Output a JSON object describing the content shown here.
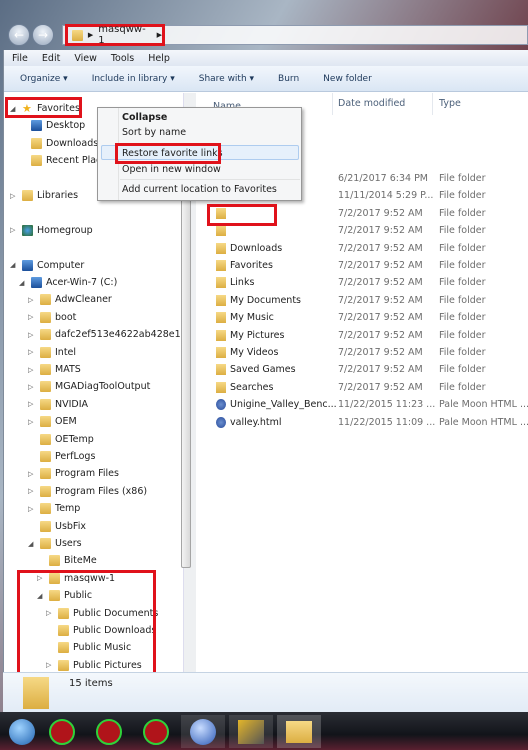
{
  "address": {
    "crumb": "masqww-1",
    "back": "back-icon",
    "forward": "forward-icon"
  },
  "menubar": [
    "File",
    "Edit",
    "View",
    "Tools",
    "Help"
  ],
  "toolbar": [
    "Organize ▾",
    "Include in library ▾",
    "Share with ▾",
    "Burn",
    "New folder"
  ],
  "nav": [
    {
      "label": "Favorites",
      "level": 0,
      "expander": "◢",
      "icon": "star",
      "gap": false
    },
    {
      "label": "Desktop",
      "level": 1,
      "expander": "",
      "icon": "desktop",
      "gap": false
    },
    {
      "label": "Downloads",
      "level": 1,
      "expander": "",
      "icon": "folder",
      "gap": false
    },
    {
      "label": "Recent Places",
      "level": 1,
      "expander": "",
      "icon": "recent",
      "gap": false
    },
    {
      "label": "Libraries",
      "level": 0,
      "expander": "▷",
      "icon": "library",
      "gap": true
    },
    {
      "label": "Homegroup",
      "level": 0,
      "expander": "▷",
      "icon": "homegroup",
      "gap": true
    },
    {
      "label": "Computer",
      "level": 0,
      "expander": "◢",
      "icon": "computer",
      "gap": true
    },
    {
      "label": "Acer-Win-7 (C:)",
      "level": 1,
      "expander": "◢",
      "icon": "drive",
      "gap": false
    },
    {
      "label": "AdwCleaner",
      "level": 2,
      "expander": "▷",
      "icon": "folder",
      "gap": false
    },
    {
      "label": "boot",
      "level": 2,
      "expander": "▷",
      "icon": "folder",
      "gap": false
    },
    {
      "label": "dafc2ef513e4622ab428e1",
      "level": 2,
      "expander": "▷",
      "icon": "folder",
      "gap": false
    },
    {
      "label": "Intel",
      "level": 2,
      "expander": "▷",
      "icon": "folder",
      "gap": false
    },
    {
      "label": "MATS",
      "level": 2,
      "expander": "▷",
      "icon": "folder",
      "gap": false
    },
    {
      "label": "MGADiagToolOutput",
      "level": 2,
      "expander": "▷",
      "icon": "folder",
      "gap": false
    },
    {
      "label": "NVIDIA",
      "level": 2,
      "expander": "▷",
      "icon": "folder",
      "gap": false
    },
    {
      "label": "OEM",
      "level": 2,
      "expander": "▷",
      "icon": "folder",
      "gap": false
    },
    {
      "label": "OETemp",
      "level": 2,
      "expander": "",
      "icon": "folder",
      "gap": false
    },
    {
      "label": "PerfLogs",
      "level": 2,
      "expander": "",
      "icon": "folder",
      "gap": false
    },
    {
      "label": "Program Files",
      "level": 2,
      "expander": "▷",
      "icon": "folder",
      "gap": false
    },
    {
      "label": "Program Files (x86)",
      "level": 2,
      "expander": "▷",
      "icon": "folder",
      "gap": false
    },
    {
      "label": "Temp",
      "level": 2,
      "expander": "▷",
      "icon": "folder",
      "gap": false
    },
    {
      "label": "UsbFix",
      "level": 2,
      "expander": "",
      "icon": "folder",
      "gap": false
    },
    {
      "label": "Users",
      "level": 2,
      "expander": "◢",
      "icon": "folder",
      "gap": false
    },
    {
      "label": "BiteMe",
      "level": 3,
      "expander": "",
      "icon": "folder",
      "gap": false
    },
    {
      "label": "masqww-1",
      "level": 3,
      "expander": "▷",
      "icon": "user-folder",
      "gap": false
    },
    {
      "label": "Public",
      "level": 3,
      "expander": "◢",
      "icon": "folder",
      "gap": false
    },
    {
      "label": "Public Documents",
      "level": 4,
      "expander": "▷",
      "icon": "folder",
      "gap": false
    },
    {
      "label": "Public Downloads",
      "level": 4,
      "expander": "",
      "icon": "folder",
      "gap": false
    },
    {
      "label": "Public Music",
      "level": 4,
      "expander": "",
      "icon": "folder",
      "gap": false
    },
    {
      "label": "Public Pictures",
      "level": 4,
      "expander": "▷",
      "icon": "folder",
      "gap": false
    }
  ],
  "columns": [
    "Name",
    "Date modified",
    "Type"
  ],
  "files": [
    {
      "name": "",
      "date": "6/21/2017 6:34 PM",
      "type": "File folder"
    },
    {
      "name": "",
      "date": "11/11/2014 5:29 P...",
      "type": "File folder"
    },
    {
      "name": "",
      "date": "7/2/2017 9:52 AM",
      "type": "File folder"
    },
    {
      "name": "",
      "date": "7/2/2017 9:52 AM",
      "type": "File folder"
    },
    {
      "name": "Downloads",
      "date": "7/2/2017 9:52 AM",
      "type": "File folder"
    },
    {
      "name": "Favorites",
      "date": "7/2/2017 9:52 AM",
      "type": "File folder"
    },
    {
      "name": "Links",
      "date": "7/2/2017 9:52 AM",
      "type": "File folder"
    },
    {
      "name": "My Documents",
      "date": "7/2/2017 9:52 AM",
      "type": "File folder"
    },
    {
      "name": "My Music",
      "date": "7/2/2017 9:52 AM",
      "type": "File folder"
    },
    {
      "name": "My Pictures",
      "date": "7/2/2017 9:52 AM",
      "type": "File folder"
    },
    {
      "name": "My Videos",
      "date": "7/2/2017 9:52 AM",
      "type": "File folder"
    },
    {
      "name": "Saved Games",
      "date": "7/2/2017 9:52 AM",
      "type": "File folder"
    },
    {
      "name": "Searches",
      "date": "7/2/2017 9:52 AM",
      "type": "File folder"
    },
    {
      "name": "Unigine_Valley_Benc...",
      "date": "11/22/2015 11:23 ...",
      "type": "Pale Moon HTML ..."
    },
    {
      "name": "valley.html",
      "date": "11/22/2015 11:09 ...",
      "type": "Pale Moon HTML ..."
    }
  ],
  "context_menu": [
    "Collapse",
    "Sort by name",
    "Restore favorite links",
    "Open in new window",
    "Add current location to Favorites"
  ],
  "status": {
    "count": "15 items"
  },
  "taskbar": [
    "start",
    "app-e",
    "app-m",
    "app-s",
    "pale-moon",
    "security-tool",
    "windows-explorer"
  ],
  "colors": {
    "highlight": "#e0121b",
    "taskbar": "#12141a"
  }
}
